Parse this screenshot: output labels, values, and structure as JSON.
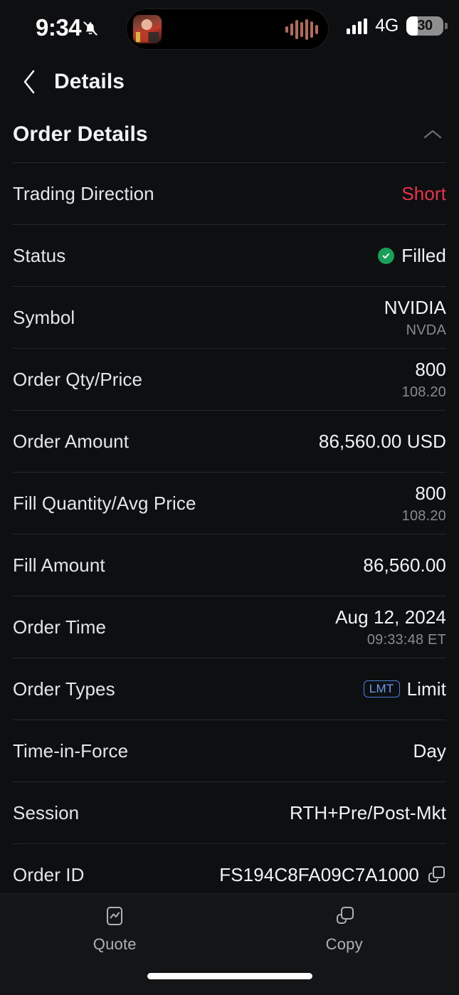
{
  "status_bar": {
    "time": "9:34",
    "silent_icon": "bell-slash-icon",
    "dynamic_island": {
      "art_icon": "album-art",
      "waveform_icon": "audio-waveform-icon"
    },
    "signal_icon": "cellular-bars-icon",
    "network": "4G",
    "battery_percent": "30"
  },
  "nav": {
    "back_icon": "chevron-left-icon",
    "title": "Details"
  },
  "section": {
    "title": "Order Details",
    "collapse_icon": "chevron-up-icon"
  },
  "rows": [
    {
      "label": "Trading Direction",
      "value": "Short",
      "sub": "",
      "style": "red"
    },
    {
      "label": "Status",
      "value": "Filled",
      "sub": "",
      "style": "check"
    },
    {
      "label": "Symbol",
      "value": "NVIDIA",
      "sub": "NVDA",
      "style": "plain"
    },
    {
      "label": "Order Qty/Price",
      "value": "800",
      "sub": "108.20",
      "style": "plain"
    },
    {
      "label": "Order Amount",
      "value": "86,560.00 USD",
      "sub": "",
      "style": "plain"
    },
    {
      "label": "Fill Quantity/Avg Price",
      "value": "800",
      "sub": "108.20",
      "style": "plain"
    },
    {
      "label": "Fill Amount",
      "value": "86,560.00",
      "sub": "",
      "style": "plain"
    },
    {
      "label": "Order Time",
      "value": "Aug 12, 2024",
      "sub": "09:33:48 ET",
      "style": "plain"
    },
    {
      "label": "Order Types",
      "value": "Limit",
      "sub": "",
      "style": "badge",
      "badge": "LMT"
    },
    {
      "label": "Time-in-Force",
      "value": "Day",
      "sub": "",
      "style": "plain"
    },
    {
      "label": "Session",
      "value": "RTH+Pre/Post-Mkt",
      "sub": "",
      "style": "plain"
    },
    {
      "label": "Order ID",
      "value": "FS194C8FA09C7A1000",
      "sub": "",
      "style": "copy"
    }
  ],
  "tabbar": {
    "items": [
      {
        "label": "Quote",
        "icon": "quote-chart-icon"
      },
      {
        "label": "Copy",
        "icon": "copy-icon"
      }
    ]
  },
  "colors": {
    "background": "#0d0f11",
    "short_red": "#e8334a",
    "filled_green": "#18a05a",
    "badge_blue": "#6e9cf0",
    "divider": "#26282b"
  }
}
